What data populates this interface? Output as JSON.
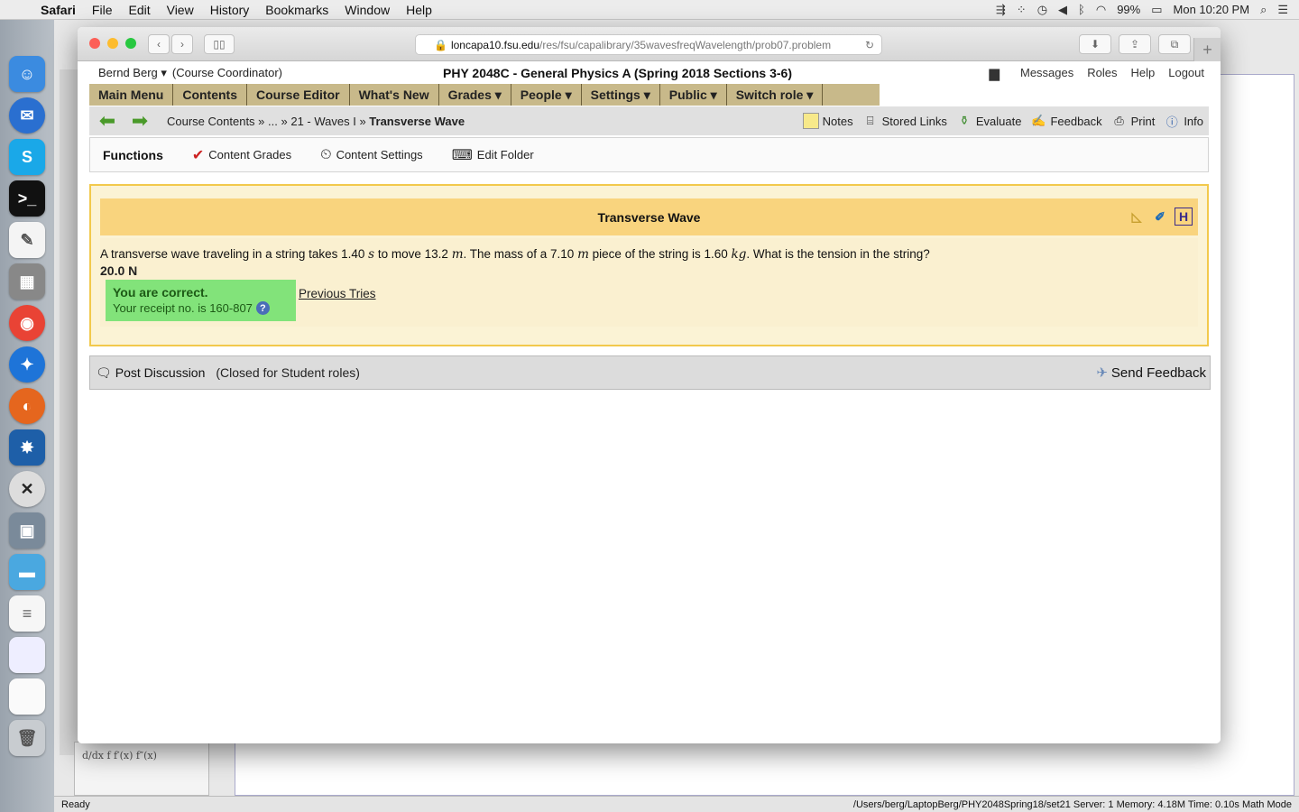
{
  "menubar": {
    "app": "Safari",
    "items": [
      "File",
      "Edit",
      "View",
      "History",
      "Bookmarks",
      "Window",
      "Help"
    ],
    "battery": "99%",
    "clock": "Mon 10:20 PM"
  },
  "browser": {
    "url_host": "loncapa10.fsu.edu",
    "url_path": "/res/fsu/capalibrary/35wavesfreqWavelength/prob07.problem"
  },
  "header": {
    "user": "Bernd Berg ▾",
    "role": "(Course Coordinator)",
    "course": "PHY 2048C - General Physics A (Spring 2018 Sections 3-6)",
    "links": [
      "Messages",
      "Roles",
      "Help",
      "Logout"
    ]
  },
  "main_menu": [
    "Main Menu",
    "Contents",
    "Course Editor",
    "What's New",
    "Grades ▾",
    "People ▾",
    "Settings ▾",
    "Public ▾",
    "Switch role ▾"
  ],
  "breadcrumb": {
    "part1": "Course Contents »",
    "part2": "... »",
    "part3": "21 - Waves I »",
    "current": "Transverse Wave"
  },
  "nav_tools": [
    "Notes",
    "Stored Links",
    "Evaluate",
    "Feedback",
    "Print",
    "Info"
  ],
  "functions": {
    "title": "Functions",
    "items": [
      "Content Grades",
      "Content Settings",
      "Edit Folder"
    ]
  },
  "problem": {
    "title": "Transverse Wave",
    "q_a": "A transverse wave traveling in a string takes 1.40",
    "q_u1": "s",
    "q_b": "to move 13.2",
    "q_u2": "m",
    "q_c": ". The mass of a 7.10",
    "q_u3": "m",
    "q_d": "piece of the string is 1.60",
    "q_u4": "kg",
    "q_e": ". What is the tension in the string?",
    "answer": "20.0 N",
    "status": "You are correct.",
    "receipt": "Your receipt no. is 160-807",
    "help_glyph": "?",
    "previous_tries": "Previous Tries"
  },
  "discussion": {
    "post": "Post Discussion",
    "closed": "(Closed for Student roles)",
    "send": "Send Feedback"
  },
  "bg_app": {
    "status": "Ready",
    "path": "/Users/berg/LaptopBerg/PHY2048Spring18/set21   Server: 1   Memory: 4.18M   Time: 0.10s   Math Mode",
    "palette": "d/dx f    f′(x)    f″(x)"
  },
  "colors": {
    "menu_bg": "#c8b98a",
    "correct_bg": "#82e37a",
    "problem_header": "#f9d47e"
  }
}
